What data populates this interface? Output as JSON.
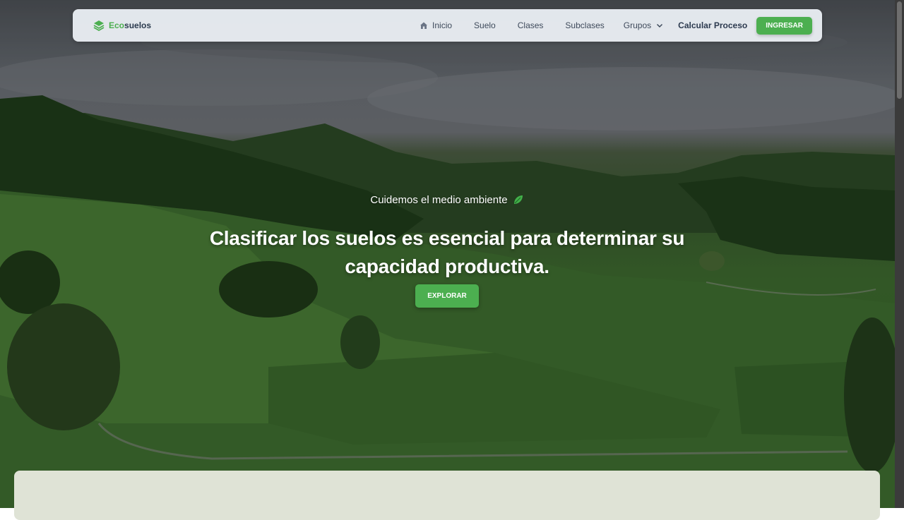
{
  "brand": {
    "eco": "Eco",
    "suelos": "suelos",
    "icon": "layers-icon"
  },
  "nav": {
    "inicio": "Inicio",
    "suelo": "Suelo",
    "clases": "Clases",
    "subclases": "Subclases",
    "grupos": "Grupos",
    "calcular": "Calcular Proceso",
    "login": "INGRESAR"
  },
  "hero": {
    "tagline": "Cuidemos el medio ambiente",
    "headline": "Clasificar los suelos es esencial para determinar su capacidad productiva.",
    "cta": "EXPLORAR"
  },
  "colors": {
    "accent": "#4caf50",
    "navText": "#3e4a5b"
  }
}
